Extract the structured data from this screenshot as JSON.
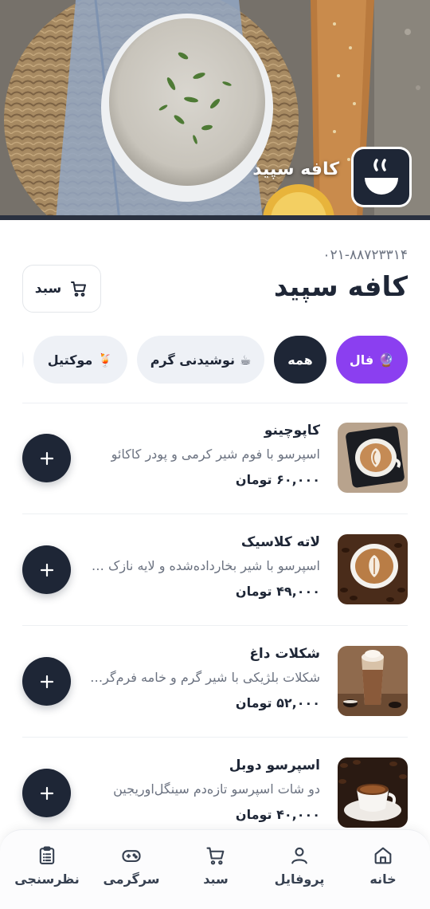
{
  "hero": {
    "title": "کافه سپید",
    "logo_icon": "steaming-cup-logo-icon"
  },
  "header": {
    "phone": "۰۲۱-۸۸۷۲۳۳۱۴",
    "cafe_name": "کافه سپید",
    "cart_button": {
      "label": "سبد",
      "icon": "cart-icon"
    }
  },
  "categories": [
    {
      "label": "فال",
      "emoji": "🔮",
      "active": false,
      "color": "#8b3ff0"
    },
    {
      "label": "همه",
      "emoji": "",
      "active": true,
      "color": "#1e2636"
    },
    {
      "label": "نوشیدنی گرم",
      "emoji": "☕"
    },
    {
      "label": "موکتیل",
      "emoji": "🍹"
    }
  ],
  "products": [
    {
      "name": "کاپوچینو",
      "description": "اسپرسو با فوم شیر کرمی و پودر کاکائو",
      "price": "۶۰,۰۰۰ تومان"
    },
    {
      "name": "لاته کلاسیک",
      "description": "اسپرسو با شیر بخارداده‌شده و لایه نازک فوم",
      "price": "۴۹,۰۰۰ تومان"
    },
    {
      "name": "شکلات داغ",
      "description": "شکلات بلژیکی با شیر گرم و خامه فرم‌گرفته",
      "price": "۵۲,۰۰۰ تومان"
    },
    {
      "name": "اسپرسو دوبل",
      "description": "دو شات اسپرسو تازه‌دم سینگل‌اوریجین",
      "price": "۴۰,۰۰۰ تومان"
    }
  ],
  "bottom_nav": {
    "home": "خانه",
    "profile": "پروفایل",
    "cart": "سبد",
    "games": "سرگرمی",
    "survey": "نظرسنجی"
  },
  "colors": {
    "primary": "#1e2636",
    "accent": "#8b3ff0",
    "chip_bg": "#eef1f6",
    "muted_text": "#6b7280"
  }
}
